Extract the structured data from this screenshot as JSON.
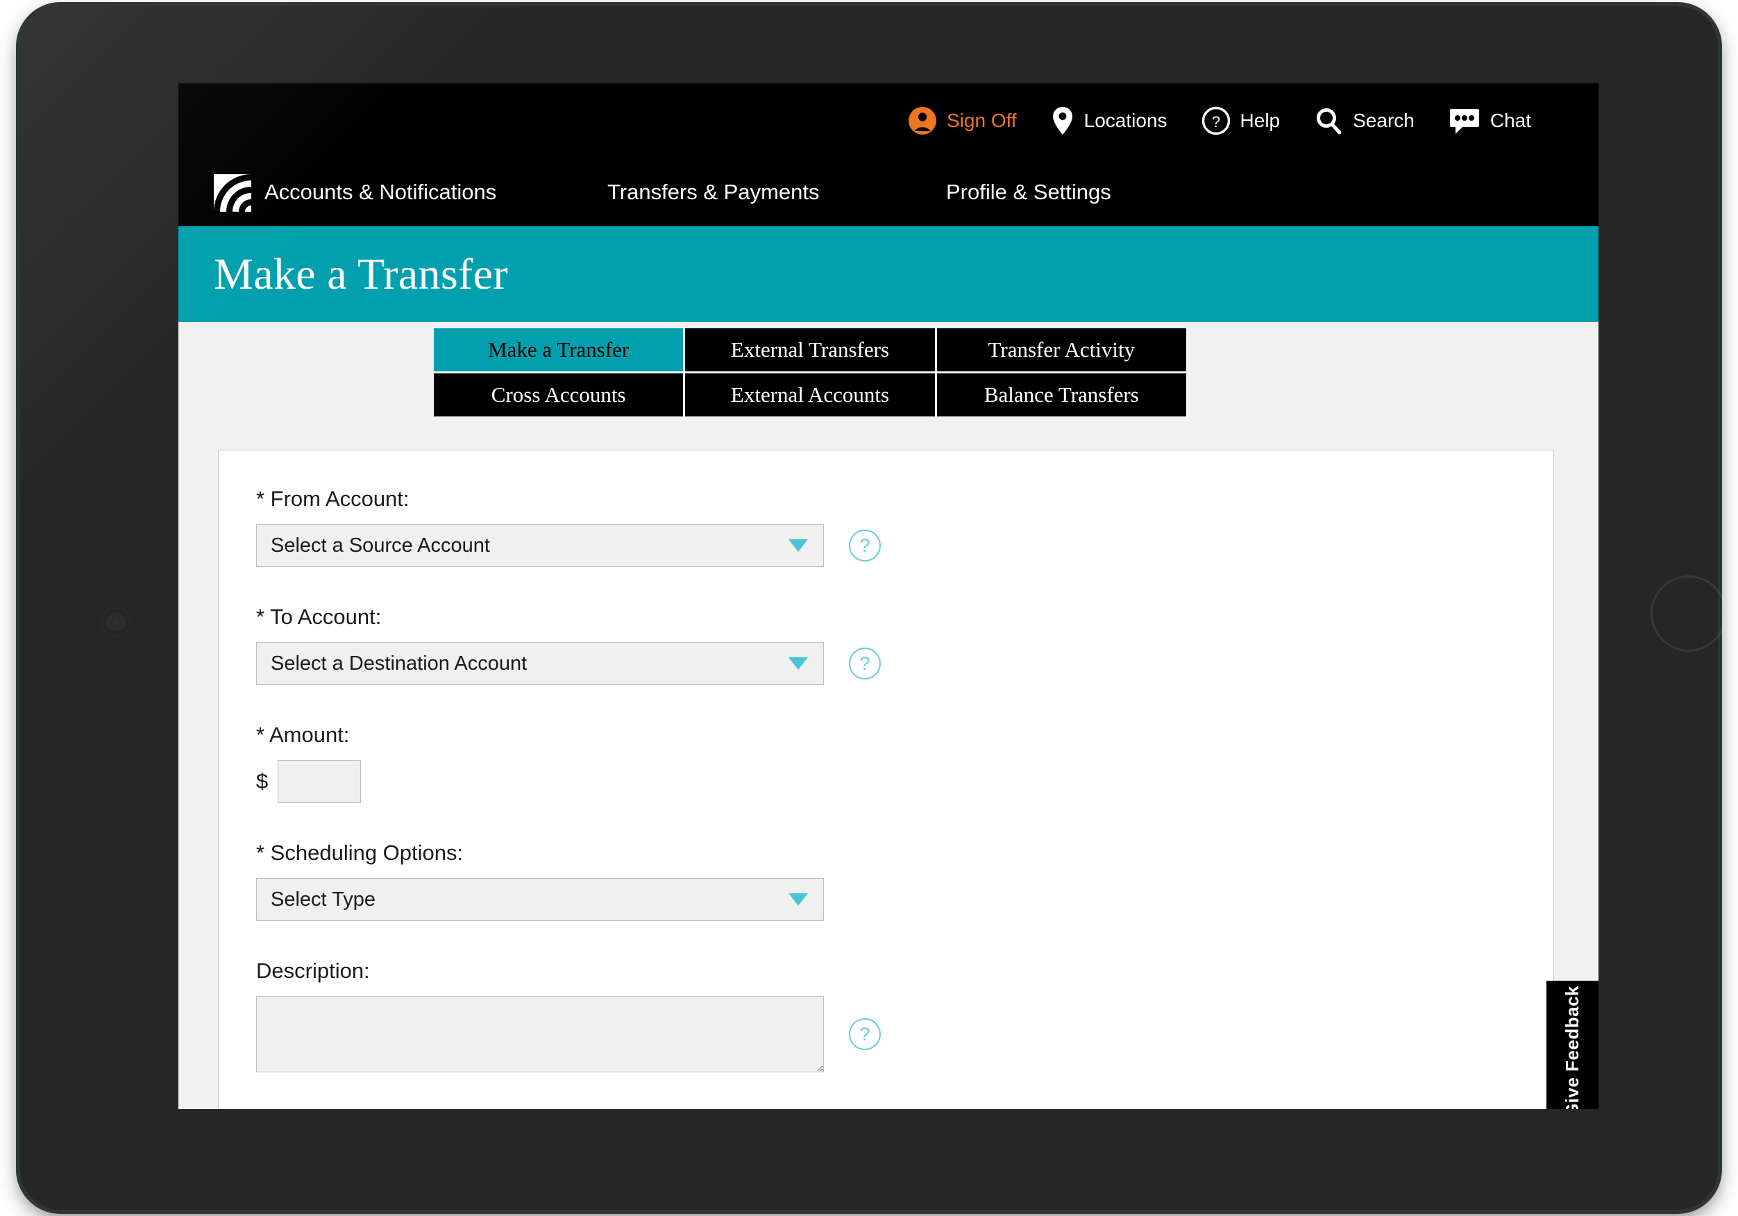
{
  "utility_bar": {
    "items": [
      {
        "label": "Sign Off",
        "icon": "user-circle-icon",
        "color": "#ee7623"
      },
      {
        "label": "Locations",
        "icon": "map-pin-icon",
        "color": "#ffffff"
      },
      {
        "label": "Help",
        "icon": "question-circle-icon",
        "color": "#ffffff"
      },
      {
        "label": "Search",
        "icon": "magnifier-icon",
        "color": "#ffffff"
      },
      {
        "label": "Chat",
        "icon": "chat-bubble-icon",
        "color": "#ffffff"
      }
    ]
  },
  "main_nav": {
    "logo_icon": "signal-arcs-logo-icon",
    "items": [
      {
        "label": "Accounts & Notifications"
      },
      {
        "label": "Transfers & Payments"
      },
      {
        "label": "Profile & Settings"
      }
    ]
  },
  "hero": {
    "title": "Make a Transfer",
    "background": "#02a0ae"
  },
  "tabs": [
    {
      "label": "Make a Transfer",
      "active": true
    },
    {
      "label": "External Transfers",
      "active": false
    },
    {
      "label": "Transfer Activity",
      "active": false
    },
    {
      "label": "Cross Accounts",
      "active": false
    },
    {
      "label": "External Accounts",
      "active": false
    },
    {
      "label": "Balance Transfers",
      "active": false
    }
  ],
  "form": {
    "from_account": {
      "label": "* From Account:",
      "value": "Select a Source Account",
      "help_glyph": "?"
    },
    "to_account": {
      "label": "* To Account:",
      "value": "Select a Destination Account",
      "help_glyph": "?"
    },
    "amount": {
      "label": "* Amount:",
      "currency_symbol": "$",
      "value": ""
    },
    "scheduling": {
      "label": "* Scheduling Options:",
      "value": "Select Type"
    },
    "description": {
      "label": "Description:",
      "value": "",
      "help_glyph": "?"
    }
  },
  "feedback_tab": {
    "label": "Give Feedback"
  }
}
